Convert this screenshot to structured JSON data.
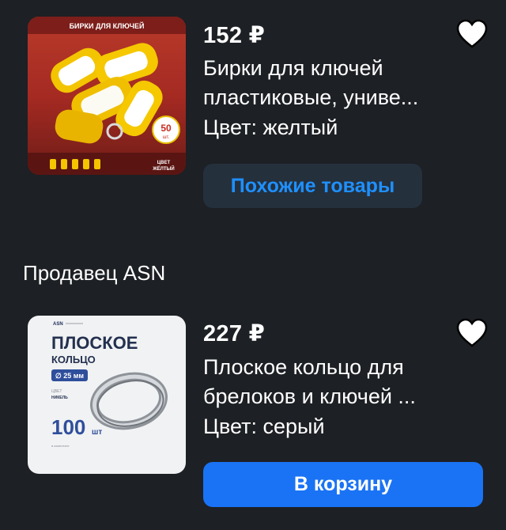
{
  "products": [
    {
      "price": "152 ₽",
      "title_line1": "Бирки для ключей",
      "title_line2": "пластиковые, униве...",
      "color_label": "Цвет: желтый",
      "action_label": "Похожие товары",
      "image": {
        "banner": "БИРКИ ДЛЯ КЛЮЧЕЙ",
        "badge_num": "50",
        "badge_unit": "шт.",
        "color_line1": "ЦВЕТ",
        "color_line2": "ЖЁЛТЫЙ"
      }
    },
    {
      "price": "227 ₽",
      "title_line1": "Плоское кольцо для",
      "title_line2": "брелоков и ключей ...",
      "color_label": "Цвет: серый",
      "action_label": "В корзину",
      "image": {
        "brand": "ASN",
        "heading1": "ПЛОСКОЕ",
        "heading2": "КОЛЬЦО",
        "size": "∅ 25 мм",
        "color_line1": "ЦВЕТ",
        "color_line2": "НИКЕЛЬ",
        "qty": "100",
        "qty_unit": "шт",
        "note": "в комплекте"
      }
    }
  ],
  "seller_label": "Продавец ASN",
  "icons": [
    "heart-icon"
  ],
  "colors": {
    "background": "#1d2024",
    "accent": "#1a73f5",
    "link": "#1e90ff",
    "chip": "#25303d"
  }
}
